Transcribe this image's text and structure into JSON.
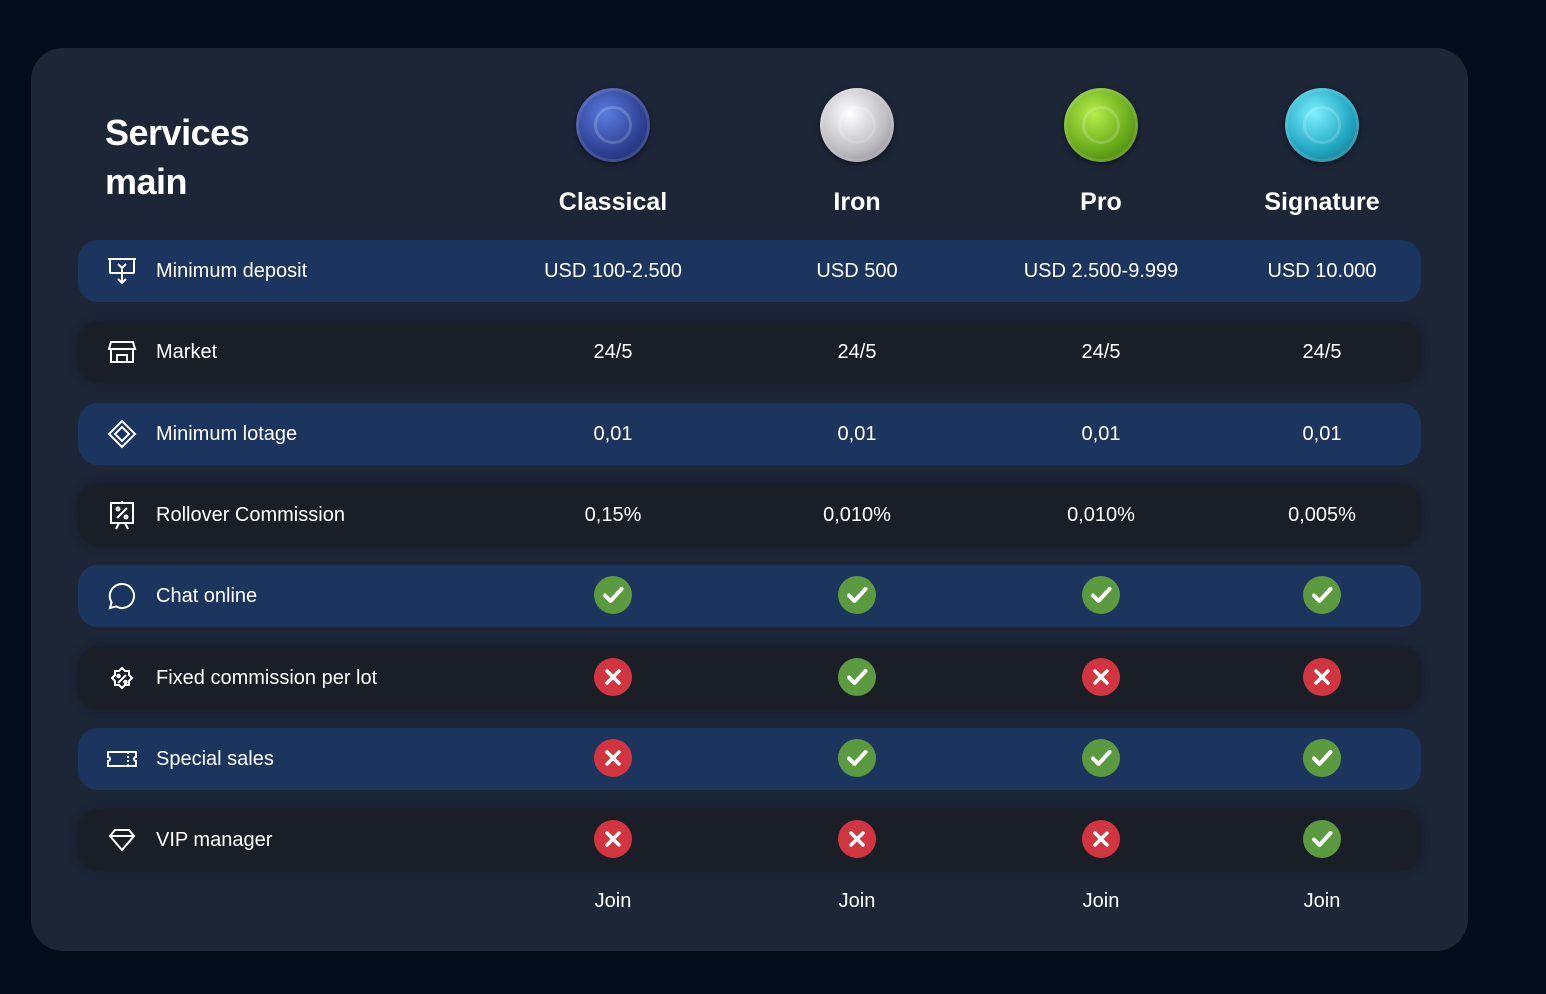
{
  "heading": {
    "line1": "Services",
    "line2": "main"
  },
  "plans": [
    {
      "name": "Classical",
      "coin_icon": "blue-coin-icon",
      "color": "#3a56b0"
    },
    {
      "name": "Iron",
      "coin_icon": "silver-coin-icon",
      "color": "#c8c8cc"
    },
    {
      "name": "Pro",
      "coin_icon": "green-coin-icon",
      "color": "#7cc12b"
    },
    {
      "name": "Signature",
      "coin_icon": "cyan-coin-icon",
      "color": "#2bb8cf"
    }
  ],
  "features": [
    {
      "label": "Minimum deposit",
      "icon": "deposit-icon",
      "style": "blue",
      "values": [
        "USD 100-2.500",
        "USD 500",
        "USD 2.500-9.999",
        "USD 10.000"
      ]
    },
    {
      "label": "Market",
      "icon": "market-store-icon",
      "style": "dark",
      "values": [
        "24/5",
        "24/5",
        "24/5",
        "24/5"
      ]
    },
    {
      "label": "Minimum lotage",
      "icon": "diamond-grid-icon",
      "style": "blue",
      "values": [
        "0,01",
        "0,01",
        "0,01",
        "0,01"
      ]
    },
    {
      "label": "Rollover Commission",
      "icon": "percent-board-icon",
      "style": "dark",
      "values": [
        "0,15%",
        "0,010%",
        "0,010%",
        "0,005%"
      ]
    },
    {
      "label": "Chat online",
      "icon": "chat-bubble-icon",
      "style": "blue",
      "checks": [
        true,
        true,
        true,
        true
      ]
    },
    {
      "label": "Fixed commission per lot",
      "icon": "percent-badge-icon",
      "style": "dark",
      "checks": [
        false,
        true,
        false,
        false
      ]
    },
    {
      "label": "Special sales",
      "icon": "ticket-icon",
      "style": "blue",
      "checks": [
        false,
        true,
        true,
        true
      ]
    },
    {
      "label": "VIP manager",
      "icon": "diamond-icon",
      "style": "dark",
      "checks": [
        false,
        false,
        false,
        true
      ]
    }
  ],
  "join_label": "Join",
  "colors": {
    "background": "#020c1b",
    "card": "#1d2637",
    "row_blue": "#1b355f",
    "row_dark": "#1a1e27",
    "check": "#5b9a3f",
    "cross": "#d2353f"
  }
}
